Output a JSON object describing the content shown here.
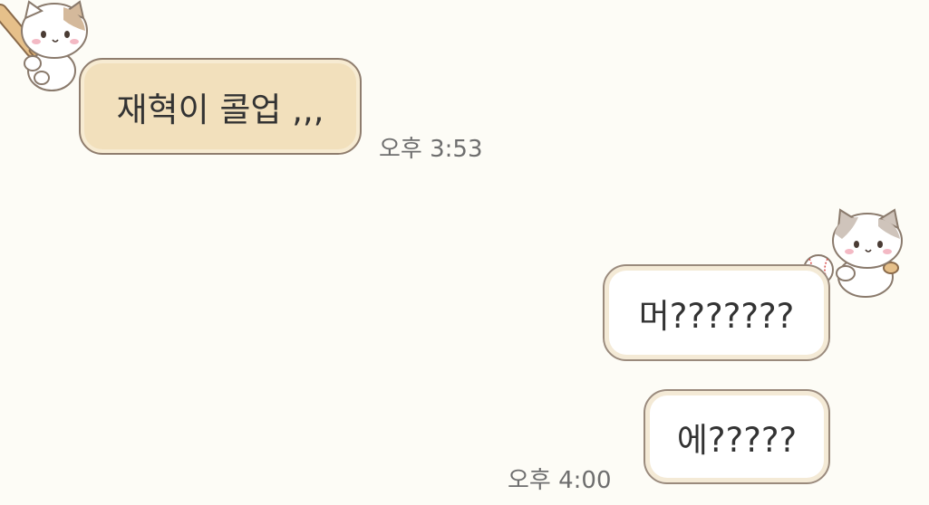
{
  "messages": [
    {
      "direction": "received",
      "text": "재혁이 콜업 ,,,",
      "time": "오후 3:53"
    },
    {
      "direction": "sent",
      "text": "머???????",
      "time": ""
    },
    {
      "direction": "sent",
      "text": "에?????",
      "time": "오후 4:00"
    }
  ],
  "stickers": [
    {
      "name": "cat-with-bat-icon"
    },
    {
      "name": "cat-with-baseball-icon"
    }
  ],
  "colors": {
    "background": "#fdfcf6",
    "received_bubble": "#f2e0bc",
    "sent_bubble": "#ffffff",
    "bubble_border": "#8f7d6e",
    "timestamp": "#6e6e6e"
  }
}
